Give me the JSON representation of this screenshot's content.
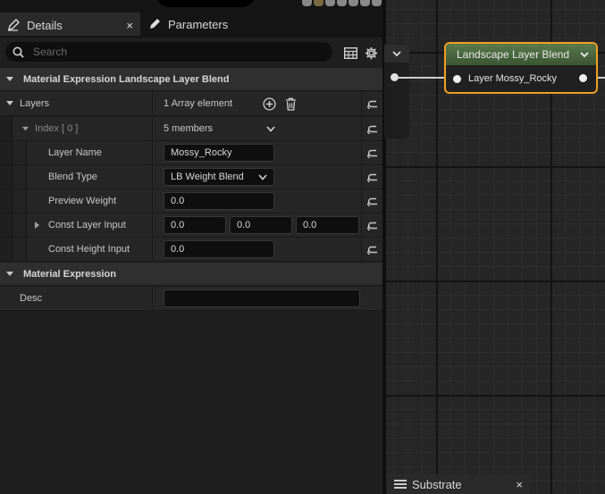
{
  "details_tab": {
    "label": "Details",
    "close": "×"
  },
  "parameters_tab": {
    "label": "Parameters"
  },
  "search": {
    "placeholder": "Search"
  },
  "sections": {
    "landscape": {
      "title": "Material Expression Landscape Layer Blend"
    },
    "expression": {
      "title": "Material Expression"
    }
  },
  "layers": {
    "label": "Layers",
    "value": "1 Array element",
    "index": {
      "label": "Index [ 0 ]",
      "value": "5 members"
    },
    "layer_name": {
      "label": "Layer Name",
      "value": "Mossy_Rocky"
    },
    "blend_type": {
      "label": "Blend Type",
      "value": "LB Weight Blend"
    },
    "preview_weight": {
      "label": "Preview Weight",
      "value": "0.0"
    },
    "const_layer_input": {
      "label": "Const Layer Input",
      "x": "0.0",
      "y": "0.0",
      "z": "0.0"
    },
    "const_height_input": {
      "label": "Const Height Input",
      "value": "0.0"
    }
  },
  "desc": {
    "label": "Desc",
    "value": ""
  },
  "graph": {
    "node_title": "Landscape Layer Blend",
    "node_pin": "Layer Mossy_Rocky",
    "accent": "#f0a020",
    "header_color": "#4d6b40"
  },
  "substrate_tab": {
    "label": "Substrate",
    "close": "×"
  }
}
